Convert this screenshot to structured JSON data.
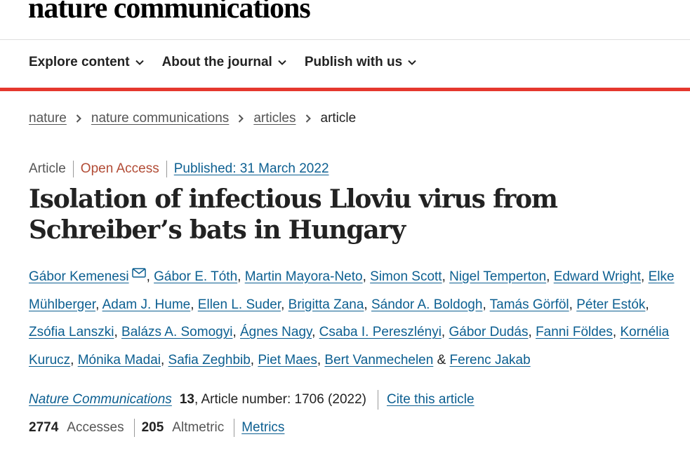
{
  "header": {
    "logo": "nature communications"
  },
  "nav": {
    "items": [
      {
        "label": "Explore content"
      },
      {
        "label": "About the journal"
      },
      {
        "label": "Publish with us"
      }
    ]
  },
  "colors": {
    "accent_bar": "#e5382e",
    "link": "#0c5f91",
    "open_access": "#b24c36"
  },
  "breadcrumb": {
    "items": [
      "nature",
      "nature communications",
      "articles"
    ],
    "current": "article"
  },
  "article": {
    "type": "Article",
    "access": "Open Access",
    "published": "Published: 31 March 2022",
    "title": "Isolation of infectious Lloviu virus from Schreiber’s bats in Hungary",
    "authors": [
      "Gábor Kemenesi",
      "Gábor E. Tóth",
      "Martin Mayora-Neto",
      "Simon Scott",
      "Nigel Temperton",
      "Edward Wright",
      "Elke Mühlberger",
      "Adam J. Hume",
      "Ellen L. Suder",
      "Brigitta Zana",
      "Sándor A. Boldogh",
      "Tamás Görföl",
      "Péter Estók",
      "Zsófia Lanszki",
      "Balázs A. Somogyi",
      "Ágnes Nagy",
      "Csaba I. Pereszlényi",
      "Gábor Dudás",
      "Fanni Földes",
      "Kornélia Kurucz",
      "Mónika Madai",
      "Safia Zeghbib",
      "Piet Maes",
      "Bert Vanmechelen",
      "Ferenc Jakab"
    ],
    "author_separator": ", ",
    "last_author_separator": " & ",
    "corresponding_icon": "envelope-icon",
    "journal": "Nature Communications",
    "volume": "13",
    "article_number": ", Article number: 1706 (2022)",
    "cite_label": "Cite this article"
  },
  "metrics": {
    "accesses_value": "2774",
    "accesses_label": "Accesses",
    "altmetric_value": "205",
    "altmetric_label": "Altmetric",
    "metrics_link": "Metrics"
  }
}
